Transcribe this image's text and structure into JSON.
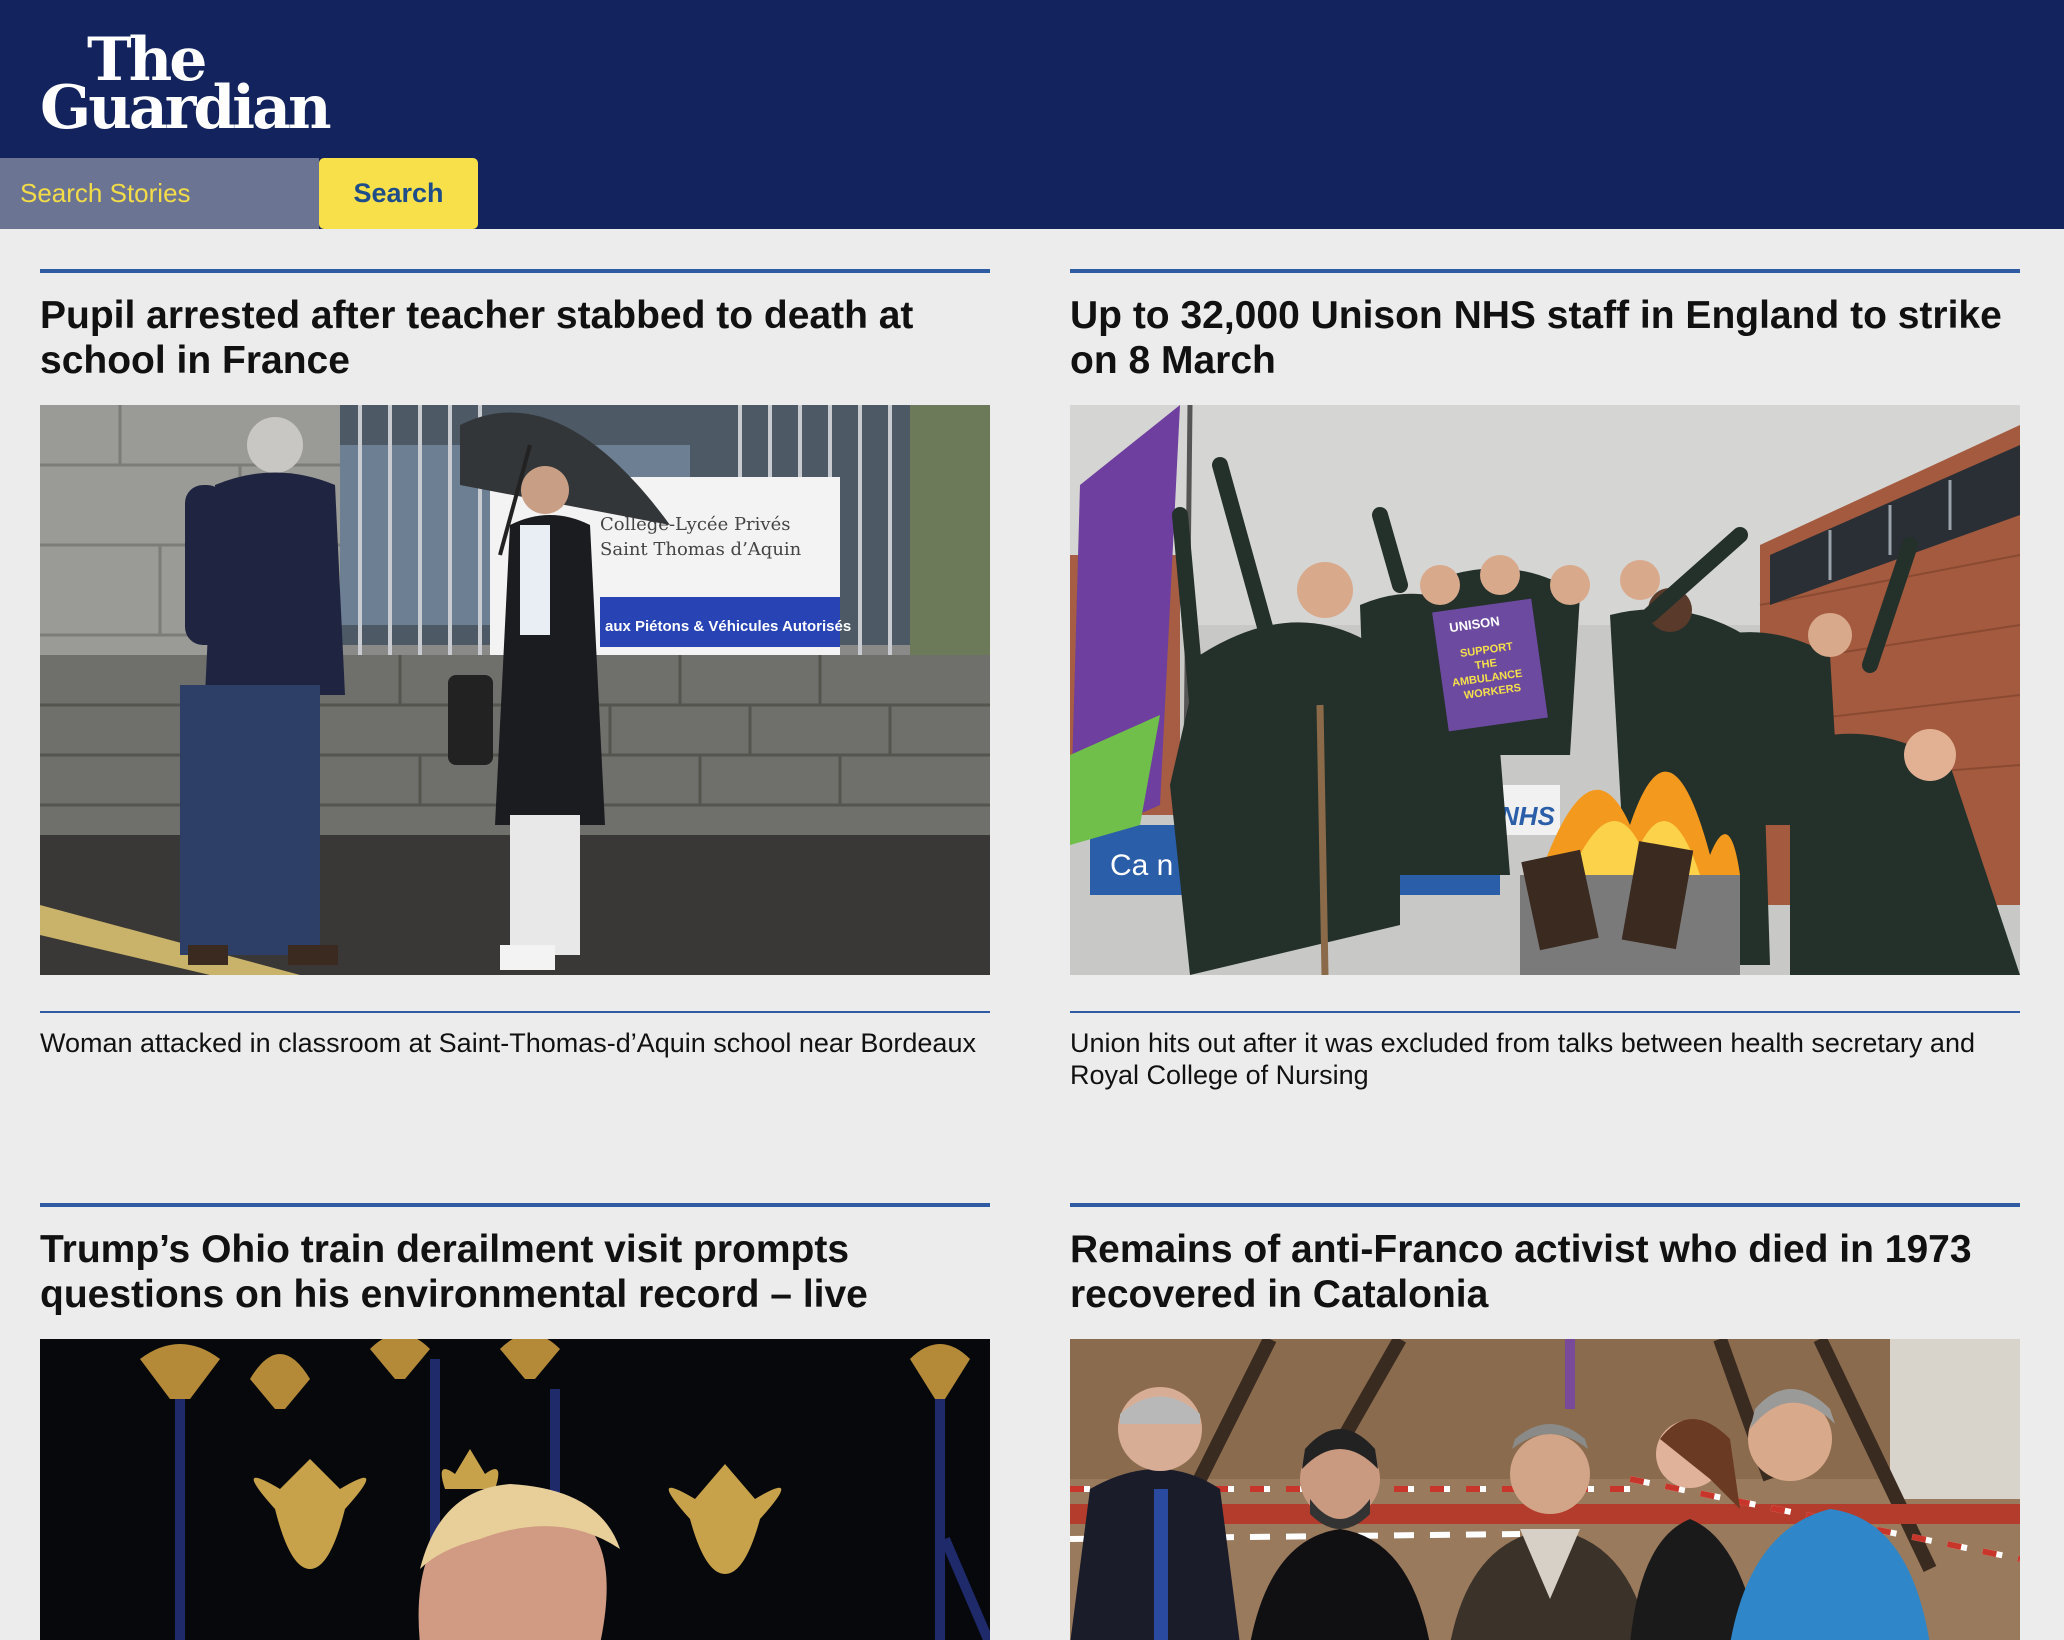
{
  "masthead": {
    "logo_line1": "The",
    "logo_line2": "Guardian"
  },
  "search": {
    "placeholder": "Search Stories",
    "value": "",
    "button_label": "Search"
  },
  "stories": [
    {
      "headline": "Pupil arrested after teacher stabbed to death at school in France",
      "standfirst": "Woman attacked in classroom at Saint-Thomas-d’Aquin school near Bordeaux",
      "photo_sign": {
        "line1": "Collège-Lycée Privés",
        "line2": "Saint Thomas d’Aquin",
        "line3": "aux Piétons & Véhicules Autorisés"
      }
    },
    {
      "headline": "Up to 32,000 Unison NHS staff in England to strike on 8 March",
      "standfirst": "Union hits out after it was excluded from talks between health secretary and Royal College of Nursing",
      "photo_sign": {
        "placard_title": "UNISON",
        "placard_line1": "SUPPORT",
        "placard_line2": "THE",
        "placard_line3": "AMBULANCE",
        "placard_line4": "WORKERS",
        "nhs": "NHS",
        "station": "Ca    n   r   ulance Stati"
      }
    },
    {
      "headline": "Trump’s Ohio train derailment visit prompts questions on his environmental record – live"
    },
    {
      "headline": "Remains of anti-Franco activist who died in 1973 recovered in Catalonia"
    }
  ],
  "colors": {
    "masthead": "#12235e",
    "accent_yellow": "#f7e04a",
    "rule_blue": "#2f5ba3",
    "page_background": "#edeced"
  }
}
